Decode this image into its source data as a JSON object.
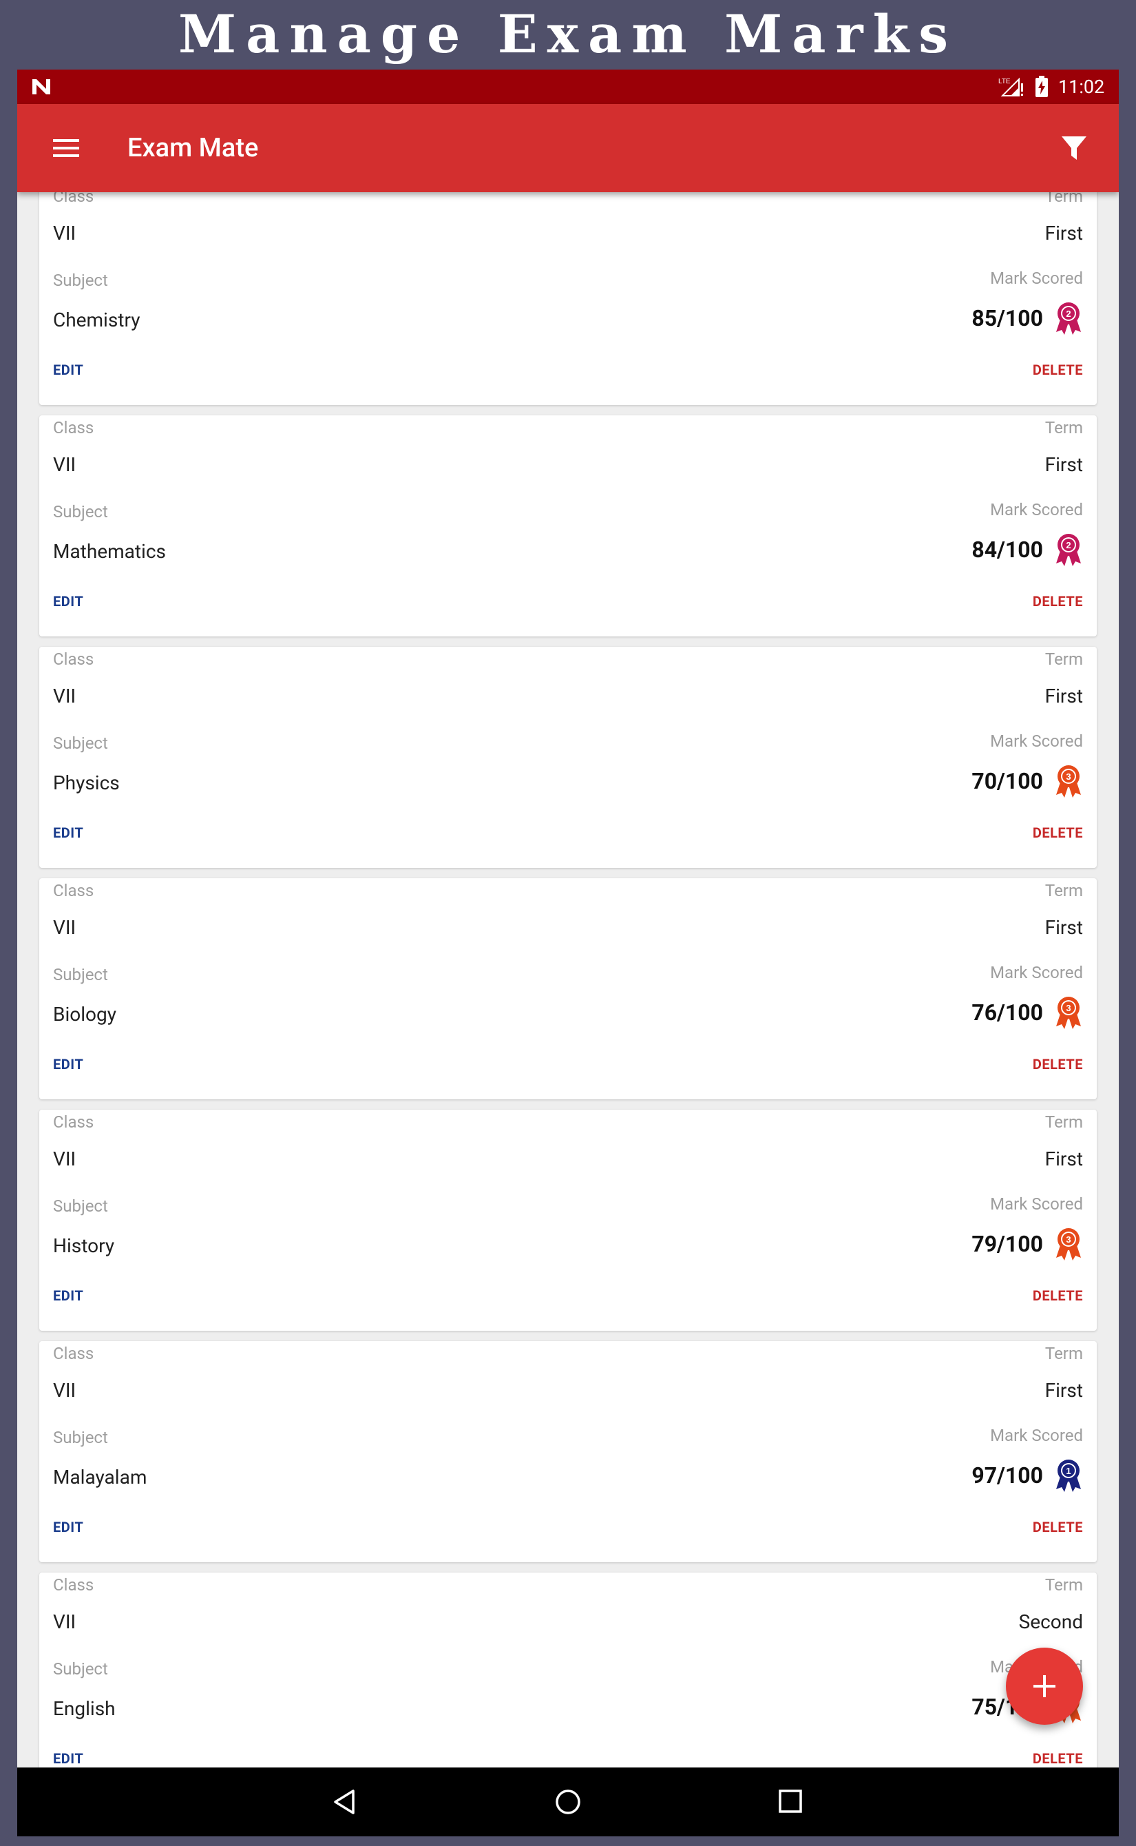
{
  "promo": {
    "title": "Manage Exam Marks"
  },
  "status_bar": {
    "time": "11:02",
    "network": "LTE"
  },
  "app_bar": {
    "title": "Exam Mate"
  },
  "labels": {
    "class": "Class",
    "term": "Term",
    "subject": "Subject",
    "mark_scored": "Mark Scored",
    "edit": "EDIT",
    "delete": "DELETE"
  },
  "colors": {
    "app_bar": "#d32f2f",
    "status_bar": "#9b0007",
    "edit": "#1a3c8c",
    "delete": "#c62828",
    "medal_rank_1": "#1a237e",
    "medal_rank_2": "#c2185b",
    "medal_rank_3": "#e64a19"
  },
  "records": [
    {
      "class": "VII",
      "term": "First",
      "subject": "Chemistry",
      "mark": "85/100",
      "medal_rank": "2",
      "medal_color": "#c2185b",
      "medal_icon": "rosette-2-icon"
    },
    {
      "class": "VII",
      "term": "First",
      "subject": "Mathematics",
      "mark": "84/100",
      "medal_rank": "2",
      "medal_color": "#c2185b",
      "medal_icon": "rosette-2-icon"
    },
    {
      "class": "VII",
      "term": "First",
      "subject": "Physics",
      "mark": "70/100",
      "medal_rank": "3",
      "medal_color": "#e64a19",
      "medal_icon": "rosette-3-icon"
    },
    {
      "class": "VII",
      "term": "First",
      "subject": "Biology",
      "mark": "76/100",
      "medal_rank": "3",
      "medal_color": "#e64a19",
      "medal_icon": "rosette-3-icon"
    },
    {
      "class": "VII",
      "term": "First",
      "subject": "History",
      "mark": "79/100",
      "medal_rank": "3",
      "medal_color": "#e64a19",
      "medal_icon": "rosette-3-icon"
    },
    {
      "class": "VII",
      "term": "First",
      "subject": "Malayalam",
      "mark": "97/100",
      "medal_rank": "1",
      "medal_color": "#1a237e",
      "medal_icon": "rosette-1-icon"
    },
    {
      "class": "VII",
      "term": "Second",
      "subject": "English",
      "mark": "75/100",
      "medal_rank": "3",
      "medal_color": "#e64a19",
      "medal_icon": "rosette-3-icon"
    }
  ],
  "fab": {
    "icon": "plus-icon",
    "color": "#e53935"
  },
  "nav_bar": {
    "icons": [
      "back-icon",
      "home-icon",
      "recents-icon"
    ]
  }
}
